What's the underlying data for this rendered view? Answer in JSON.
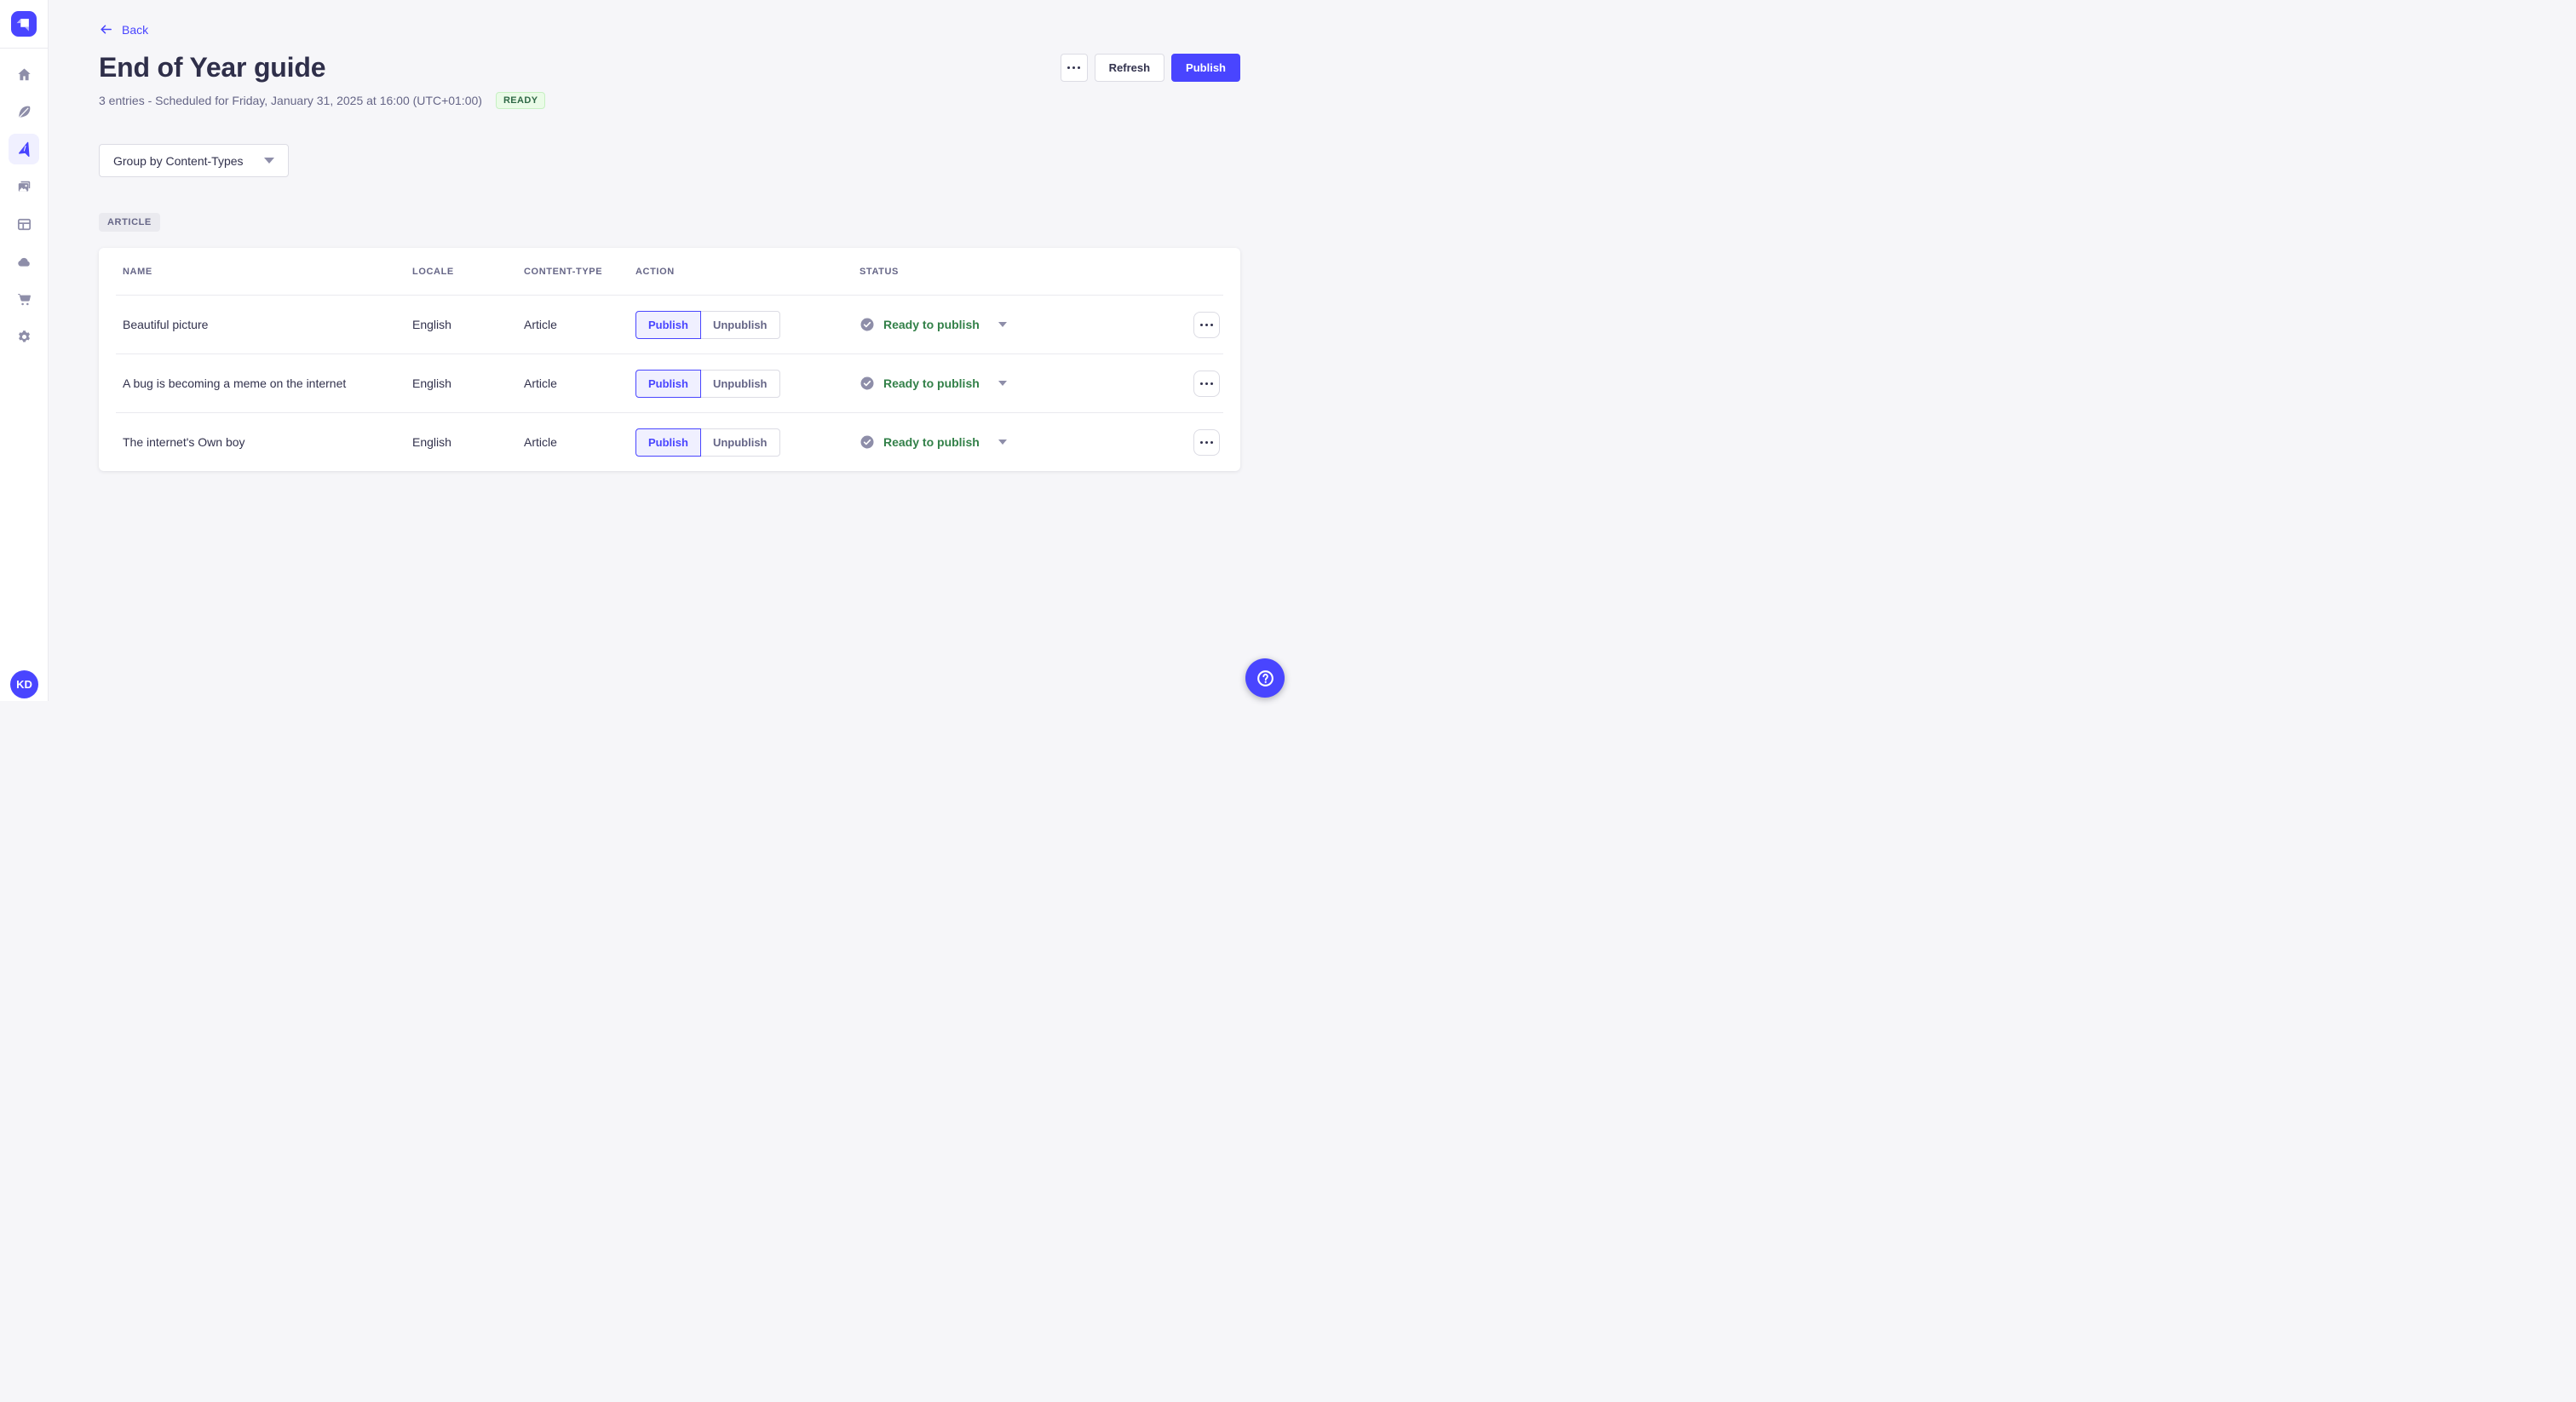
{
  "colors": {
    "primary": "#4945ff",
    "primary_light_bg": "#f0f0ff",
    "page_bg": "#f6f6f9",
    "text_dark": "#32324d",
    "text_secondary": "#666687",
    "icon_gray": "#8e8ea9",
    "border": "#dcdce4",
    "divider": "#eaeaef",
    "status_green_text": "#328048",
    "ready_badge_bg": "#eafbe7",
    "ready_badge_border": "#c6f0c2",
    "ready_badge_text": "#2f6846"
  },
  "sidebar": {
    "logo_icon": "strapi-logo-icon",
    "nav_items": [
      {
        "id": "home",
        "icon": "home-icon",
        "active": false
      },
      {
        "id": "content-manager",
        "icon": "feather-icon",
        "active": false
      },
      {
        "id": "releases",
        "icon": "paper-plane-icon",
        "active": true
      },
      {
        "id": "media-library",
        "icon": "images-icon",
        "active": false
      },
      {
        "id": "content-type-builder",
        "icon": "layout-icon",
        "active": false
      },
      {
        "id": "cloud",
        "icon": "cloud-icon",
        "active": false
      },
      {
        "id": "marketplace",
        "icon": "cart-icon",
        "active": false
      },
      {
        "id": "settings",
        "icon": "gear-icon",
        "active": false
      }
    ],
    "avatar_initials": "KD"
  },
  "header": {
    "back_label": "Back",
    "title": "End of Year guide",
    "subtitle": "3 entries - Scheduled for Friday, January 31, 2025 at 16:00 (UTC+01:00)",
    "release_status_badge": "READY",
    "refresh_button_label": "Refresh",
    "publish_button_label": "Publish",
    "more_button_icon": "ellipsis-icon"
  },
  "toolbar": {
    "group_by_value": "Group by Content-Types",
    "caret_icon": "chevron-down-icon"
  },
  "content_group": {
    "badge_label": "ARTICLE"
  },
  "table": {
    "headers": {
      "name": "NAME",
      "locale": "LOCALE",
      "content_type": "CONTENT-TYPE",
      "action": "ACTION",
      "status": "STATUS"
    },
    "rows": [
      {
        "name": "Beautiful picture",
        "locale": "English",
        "content_type": "Article",
        "publish_label": "Publish",
        "unpublish_label": "Unpublish",
        "status_label": "Ready to publish",
        "status_icon": "check-circle-icon",
        "menu_icon": "ellipsis-icon"
      },
      {
        "name": "A bug is becoming a meme on the internet",
        "locale": "English",
        "content_type": "Article",
        "publish_label": "Publish",
        "unpublish_label": "Unpublish",
        "status_label": "Ready to publish",
        "status_icon": "check-circle-icon",
        "menu_icon": "ellipsis-icon"
      },
      {
        "name": "The internet's Own boy",
        "locale": "English",
        "content_type": "Article",
        "publish_label": "Publish",
        "unpublish_label": "Unpublish",
        "status_label": "Ready to publish",
        "status_icon": "check-circle-icon",
        "menu_icon": "ellipsis-icon"
      }
    ]
  },
  "fab": {
    "icon": "help-icon"
  }
}
